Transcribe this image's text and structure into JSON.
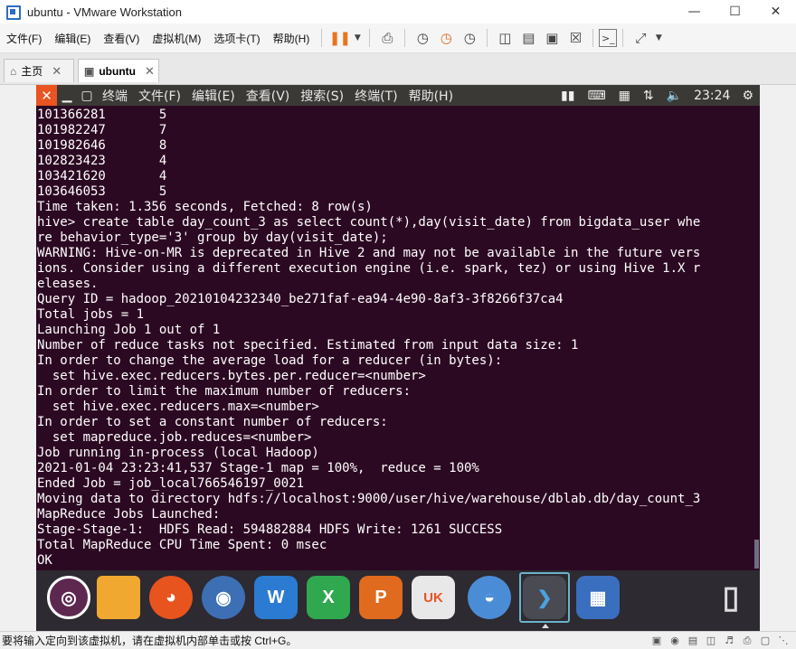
{
  "window": {
    "title": "ubuntu - VMware Workstation"
  },
  "menubar": {
    "items": [
      "文件(F)",
      "编辑(E)",
      "查看(V)",
      "虚拟机(M)",
      "选项卡(T)",
      "帮助(H)"
    ],
    "toolbar_icons": [
      "pause-icon",
      "dropdown-icon",
      "send-keys-icon",
      "snapshot-icon",
      "restore-snapshot-icon",
      "snapshot-manager-icon",
      "sidebar-icon",
      "thumbnail-icon",
      "fullscreen-icon",
      "unity-icon",
      "console-icon",
      "stretch-icon",
      "dropdown-icon"
    ]
  },
  "tabs": [
    {
      "label": "主页",
      "icon": "home-icon"
    },
    {
      "label": "ubuntu",
      "icon": "vm-icon"
    }
  ],
  "ubuntu_topbar": {
    "menus": [
      "终端",
      "文件(F)",
      "编辑(E)",
      "查看(V)",
      "搜索(S)",
      "终端(T)",
      "帮助(H)"
    ],
    "clock": "23:24"
  },
  "terminal": {
    "lines": [
      "101366281       5",
      "101982247       7",
      "101982646       8",
      "102823423       4",
      "103421620       4",
      "103646053       5",
      "Time taken: 1.356 seconds, Fetched: 8 row(s)",
      "hive> create table day_count_3 as select count(*),day(visit_date) from bigdata_user whe",
      "re behavior_type='3' group by day(visit_date);",
      "WARNING: Hive-on-MR is deprecated in Hive 2 and may not be available in the future vers",
      "ions. Consider using a different execution engine (i.e. spark, tez) or using Hive 1.X r",
      "eleases.",
      "Query ID = hadoop_20210104232340_be271faf-ea94-4e90-8af3-3f8266f37ca4",
      "Total jobs = 1",
      "Launching Job 1 out of 1",
      "Number of reduce tasks not specified. Estimated from input data size: 1",
      "In order to change the average load for a reducer (in bytes):",
      "  set hive.exec.reducers.bytes.per.reducer=<number>",
      "In order to limit the maximum number of reducers:",
      "  set hive.exec.reducers.max=<number>",
      "In order to set a constant number of reducers:",
      "  set mapreduce.job.reduces=<number>",
      "Job running in-process (local Hadoop)",
      "2021-01-04 23:23:41,537 Stage-1 map = 100%,  reduce = 100%",
      "Ended Job = job_local766546197_0021",
      "Moving data to directory hdfs://localhost:9000/user/hive/warehouse/dblab.db/day_count_3",
      "MapReduce Jobs Launched:",
      "Stage-Stage-1:  HDFS Read: 594882884 HDFS Write: 1261 SUCCESS",
      "Total MapReduce CPU Time Spent: 0 msec",
      "OK"
    ]
  },
  "dock": {
    "items": [
      {
        "name": "ubuntu-logo-icon",
        "color": "#5e2750"
      },
      {
        "name": "files-icon",
        "color": "#f0a830"
      },
      {
        "name": "firefox-icon",
        "color": "#e8541e"
      },
      {
        "name": "chromium-icon",
        "color": "#3d6fb5"
      },
      {
        "name": "writer-icon",
        "color": "#2a7bd1"
      },
      {
        "name": "calc-icon",
        "color": "#2fa84f"
      },
      {
        "name": "impress-icon",
        "color": "#e06b1f"
      },
      {
        "name": "ubuntu-software-icon",
        "color": "#e8e8e8"
      },
      {
        "name": "remote-desktop-icon",
        "color": "#4a8dd6"
      },
      {
        "name": "terminal-icon",
        "color": "#4a4a52"
      },
      {
        "name": "workspace-icon",
        "color": "#3a6ebf"
      },
      {
        "name": "trash-icon",
        "color": "#d0d0d0"
      }
    ],
    "labels": {
      "writer": "W",
      "calc": "X",
      "impress": "P",
      "software": "UK"
    }
  },
  "statusbar": {
    "text": "要将输入定向到该虚拟机，请在虚拟机内部单击或按 Ctrl+G。"
  },
  "colors": {
    "terminal_bg": "#2c0922",
    "ubuntu_orange": "#e95420",
    "vmware_pause": "#e8741c"
  }
}
